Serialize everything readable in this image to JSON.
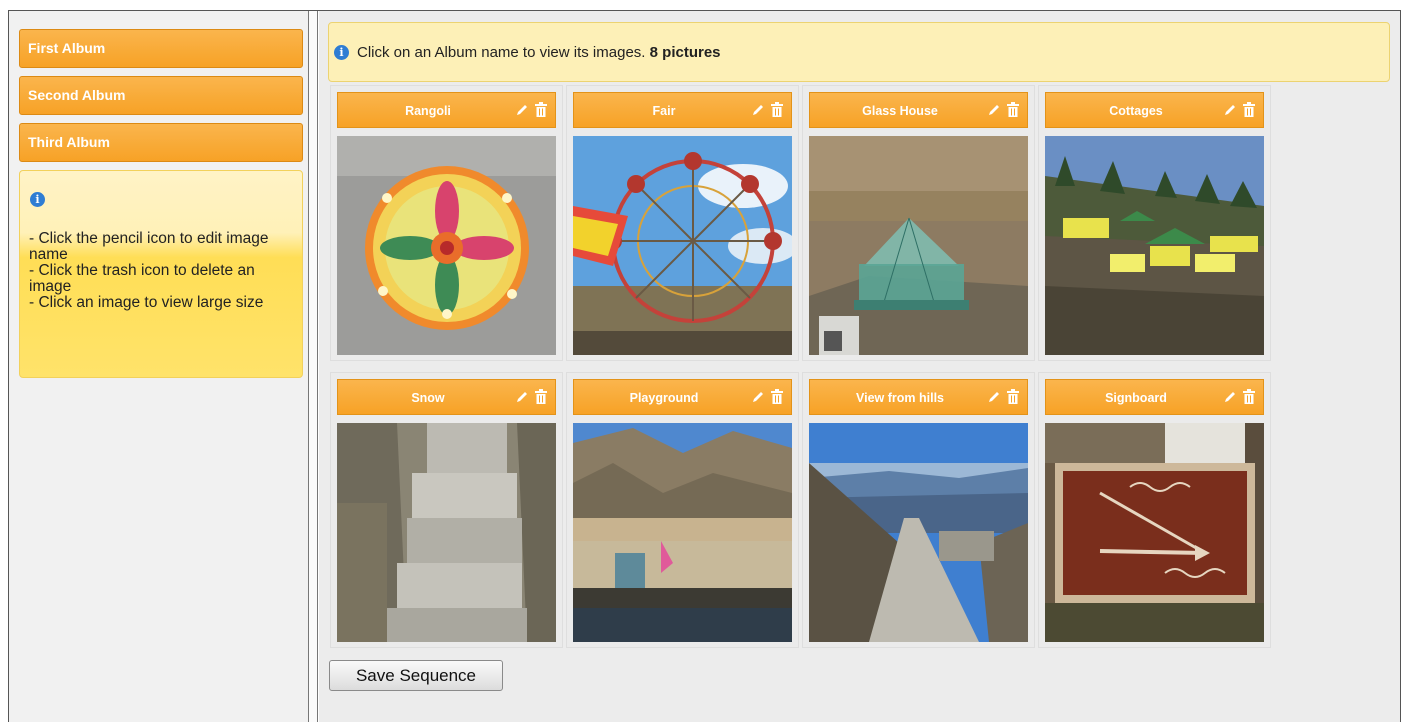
{
  "sidebar": {
    "albums": [
      {
        "label": "First Album"
      },
      {
        "label": "Second Album"
      },
      {
        "label": "Third Album"
      }
    ],
    "help_icon": "info-icon",
    "help_lines": [
      "- Click the pencil icon to edit image name",
      "- Click the trash icon to delete an image",
      "- Click an image to view large size"
    ]
  },
  "main": {
    "info_icon": "info-icon",
    "info_text": "Click on an Album name to view its images.",
    "info_count": "8 pictures",
    "images": [
      {
        "title": "Rangoli",
        "picture": "rangoli"
      },
      {
        "title": "Fair",
        "picture": "ferris-wheel"
      },
      {
        "title": "Glass House",
        "picture": "glass-house"
      },
      {
        "title": "Cottages",
        "picture": "cottages"
      },
      {
        "title": "Snow",
        "picture": "snowy-steps"
      },
      {
        "title": "Playground",
        "picture": "playground"
      },
      {
        "title": "View from hills",
        "picture": "mountain-path"
      },
      {
        "title": "Signboard",
        "picture": "signboard"
      }
    ],
    "tile_icons": {
      "edit": "pencil-icon",
      "delete": "trash-icon"
    },
    "save_label": "Save Sequence"
  },
  "colors": {
    "accent_orange": "#f7a226",
    "help_yellow": "#ffde56",
    "info_bar": "#fdf0b7",
    "info_icon": "#2f7dd3"
  }
}
